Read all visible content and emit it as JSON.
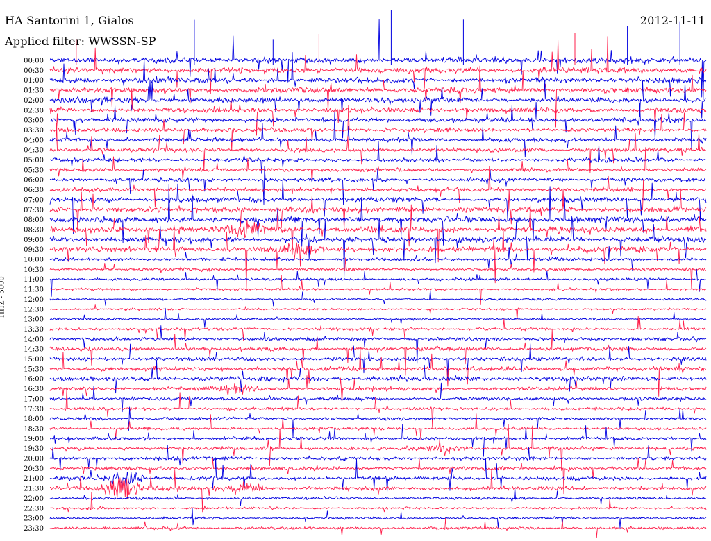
{
  "header": {
    "station": "HA Santorini 1, Gialos",
    "filter": "Applied filter: WWSSN-SP",
    "date": "2012-11-11",
    "channel": "HHZ - 5000"
  },
  "chart_data": {
    "type": "line",
    "title": "HA Santorini 1, Gialos",
    "subtitle": "Applied filter: WWSSN-SP",
    "date": "2012-11-11",
    "ylabel": "HHZ - 5000",
    "row_interval_minutes": 30,
    "row_labels": [
      "00:00",
      "00:30",
      "01:00",
      "01:30",
      "02:00",
      "02:30",
      "03:00",
      "03:30",
      "04:00",
      "04:30",
      "05:00",
      "05:30",
      "06:00",
      "06:30",
      "07:00",
      "07:30",
      "08:00",
      "08:30",
      "09:00",
      "09:30",
      "10:00",
      "10:30",
      "11:00",
      "11:30",
      "12:00",
      "12:30",
      "13:00",
      "13:30",
      "14:00",
      "14:30",
      "15:00",
      "15:30",
      "16:00",
      "16:30",
      "17:00",
      "17:30",
      "18:00",
      "18:30",
      "19:00",
      "19:30",
      "20:00",
      "20:30",
      "21:00",
      "21:30",
      "22:00",
      "22:30",
      "23:00",
      "23:30"
    ],
    "series_colors": [
      "#0000e0",
      "#ff1f4b"
    ],
    "relative_amplitude": [
      1.0,
      1.0,
      0.9,
      0.9,
      0.9,
      0.85,
      0.8,
      0.75,
      0.7,
      0.7,
      0.65,
      0.6,
      0.65,
      0.7,
      0.85,
      0.95,
      1.0,
      1.0,
      1.0,
      1.0,
      0.55,
      0.5,
      0.45,
      0.4,
      0.35,
      0.35,
      0.4,
      0.5,
      0.6,
      0.65,
      0.7,
      0.75,
      0.8,
      0.7,
      0.55,
      0.5,
      0.5,
      0.5,
      0.55,
      0.6,
      0.6,
      0.6,
      0.65,
      0.7,
      0.45,
      0.4,
      0.4,
      0.45
    ],
    "events": [
      {
        "row": "21:30",
        "position": 0.11,
        "strength": 3.0
      },
      {
        "row": "21:00",
        "position": 0.11,
        "strength": 2.0
      },
      {
        "row": "21:30",
        "position": 0.3,
        "strength": 1.2
      },
      {
        "row": "19:30",
        "position": 0.6,
        "strength": 1.2
      },
      {
        "row": "16:30",
        "position": 0.28,
        "strength": 1.2
      },
      {
        "row": "08:30",
        "position": 0.3,
        "strength": 1.4
      },
      {
        "row": "09:30",
        "position": 0.38,
        "strength": 1.3
      }
    ]
  }
}
